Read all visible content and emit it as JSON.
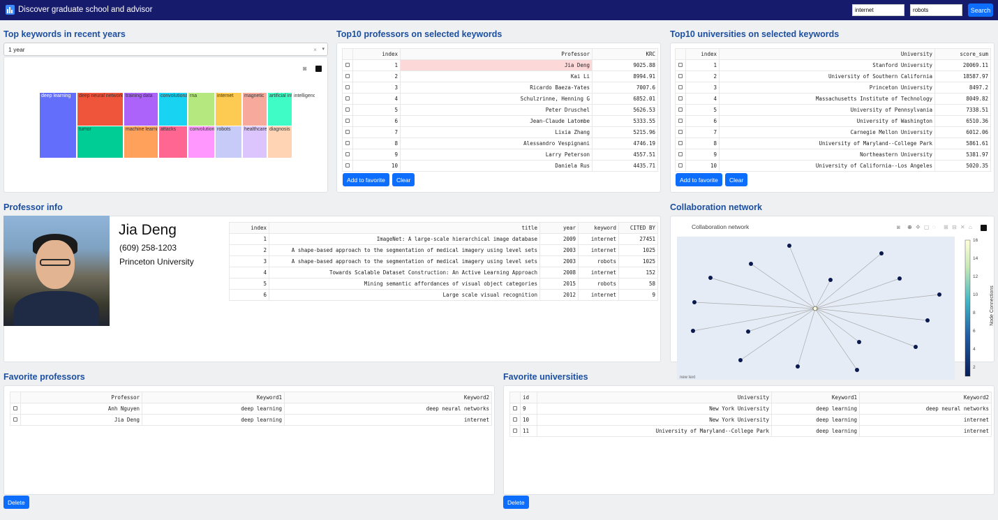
{
  "header": {
    "title": "Discover graduate school and advisor",
    "keyword1": "internet",
    "keyword2": "robots",
    "search_label": "Search"
  },
  "keywords_section": {
    "title": "Top keywords in recent years",
    "range_selected": "1 year"
  },
  "treemap": {
    "tiles": [
      {
        "label": "deep learning",
        "color": "#636efa"
      },
      {
        "label": "deep neural networks",
        "color": "#ef553b"
      },
      {
        "label": "tumor",
        "color": "#00cc96"
      },
      {
        "label": "training data",
        "color": "#ab63fa"
      },
      {
        "label": "machine learning",
        "color": "#ffa15a"
      },
      {
        "label": "convolutional",
        "color": "#19d3f3"
      },
      {
        "label": "attacks",
        "color": "#ff6692"
      },
      {
        "label": "rna",
        "color": "#b6e880"
      },
      {
        "label": "convolution",
        "color": "#ff97ff"
      },
      {
        "label": "internet",
        "color": "#fecb52"
      },
      {
        "label": "robots",
        "color": "#c6cbf7"
      },
      {
        "label": "magnetic",
        "color": "#f7a99b"
      },
      {
        "label": "healthcare",
        "color": "#dcc4fc"
      },
      {
        "label": "artificial intelligence",
        "color": "#3ffcc6"
      },
      {
        "label": "diagnosis",
        "color": "#ffd4b4"
      },
      {
        "label": "intelligence",
        "color": "#ffffff"
      }
    ]
  },
  "top_professors": {
    "title": "Top10 professors on selected keywords",
    "columns": [
      "index",
      "Professor",
      "KRC"
    ],
    "rows": [
      [
        "1",
        "Jia Deng",
        "9025.88"
      ],
      [
        "2",
        "Kai Li",
        "8994.91"
      ],
      [
        "3",
        "Ricardo Baeza-Yates",
        "7007.6"
      ],
      [
        "4",
        "Schulzrinne, Henning G",
        "6852.01"
      ],
      [
        "5",
        "Peter Druschel",
        "5626.53"
      ],
      [
        "6",
        "Jean-Claude Latombe",
        "5333.55"
      ],
      [
        "7",
        "Lixia Zhang",
        "5215.96"
      ],
      [
        "8",
        "Alessandro Vespignani",
        "4746.19"
      ],
      [
        "9",
        "Larry Peterson",
        "4557.51"
      ],
      [
        "10",
        "Daniela Rus",
        "4435.71"
      ]
    ],
    "add_label": "Add to favorite",
    "clear_label": "Clear"
  },
  "top_universities": {
    "title": "Top10 universities on selected keywords",
    "columns": [
      "index",
      "University",
      "score_sum"
    ],
    "rows": [
      [
        "1",
        "Stanford University",
        "20069.11"
      ],
      [
        "2",
        "University of Southern California",
        "18587.97"
      ],
      [
        "3",
        "Princeton University",
        "8497.2"
      ],
      [
        "4",
        "Massachusetts Institute of Technology",
        "8049.82"
      ],
      [
        "5",
        "University of Pennsylvania",
        "7338.51"
      ],
      [
        "6",
        "University of Washington",
        "6510.36"
      ],
      [
        "7",
        "Carnegie Mellon University",
        "6012.06"
      ],
      [
        "8",
        "University of Maryland--College Park",
        "5861.61"
      ],
      [
        "9",
        "Northeastern University",
        "5381.97"
      ],
      [
        "10",
        "University of California--Los Angeles",
        "5020.35"
      ]
    ],
    "add_label": "Add to favorite",
    "clear_label": "Clear"
  },
  "professor_info": {
    "title": "Professor info",
    "name": "Jia Deng",
    "phone": "(609) 258-1203",
    "university": "Princeton University",
    "columns": [
      "index",
      "title",
      "year",
      "keyword",
      "CITED BY"
    ],
    "rows": [
      [
        "1",
        "ImageNet: A large-scale hierarchical image database",
        "2009",
        "internet",
        "27451"
      ],
      [
        "2",
        "A shape-based approach to the segmentation of medical imagery using level sets",
        "2003",
        "internet",
        "1025"
      ],
      [
        "3",
        "A shape-based approach to the segmentation of medical imagery using level sets",
        "2003",
        "robots",
        "1025"
      ],
      [
        "4",
        "Towards Scalable Dataset Construction: An Active Learning Approach",
        "2008",
        "internet",
        "152"
      ],
      [
        "5",
        "Mining semantic affordances of visual object categories",
        "2015",
        "robots",
        "58"
      ],
      [
        "6",
        "Large scale visual recognition",
        "2012",
        "internet",
        "9"
      ]
    ]
  },
  "collab": {
    "section_title": "Collaboration network",
    "plot_title": "Collaboration network",
    "colorbar_label": "Node Connections",
    "colorbar_ticks": [
      "16",
      "14",
      "12",
      "10",
      "8",
      "6",
      "4",
      "2"
    ],
    "footnote": "new text"
  },
  "fav_professors": {
    "title": "Favorite professors",
    "columns": [
      "Professor",
      "Keyword1",
      "Keyword2"
    ],
    "rows": [
      [
        "Anh Nguyen",
        "deep learning",
        "deep neural networks"
      ],
      [
        "Jia Deng",
        "deep learning",
        "internet"
      ]
    ],
    "delete_label": "Delete"
  },
  "fav_universities": {
    "title": "Favorite universities",
    "columns": [
      "id",
      "University",
      "Keyword1",
      "Keyword2"
    ],
    "rows": [
      [
        "9",
        "New York University",
        "deep learning",
        "deep neural networks"
      ],
      [
        "10",
        "New York University",
        "deep learning",
        "internet"
      ],
      [
        "11",
        "University of Maryland--College Park",
        "deep learning",
        "internet"
      ]
    ],
    "delete_label": "Delete"
  }
}
